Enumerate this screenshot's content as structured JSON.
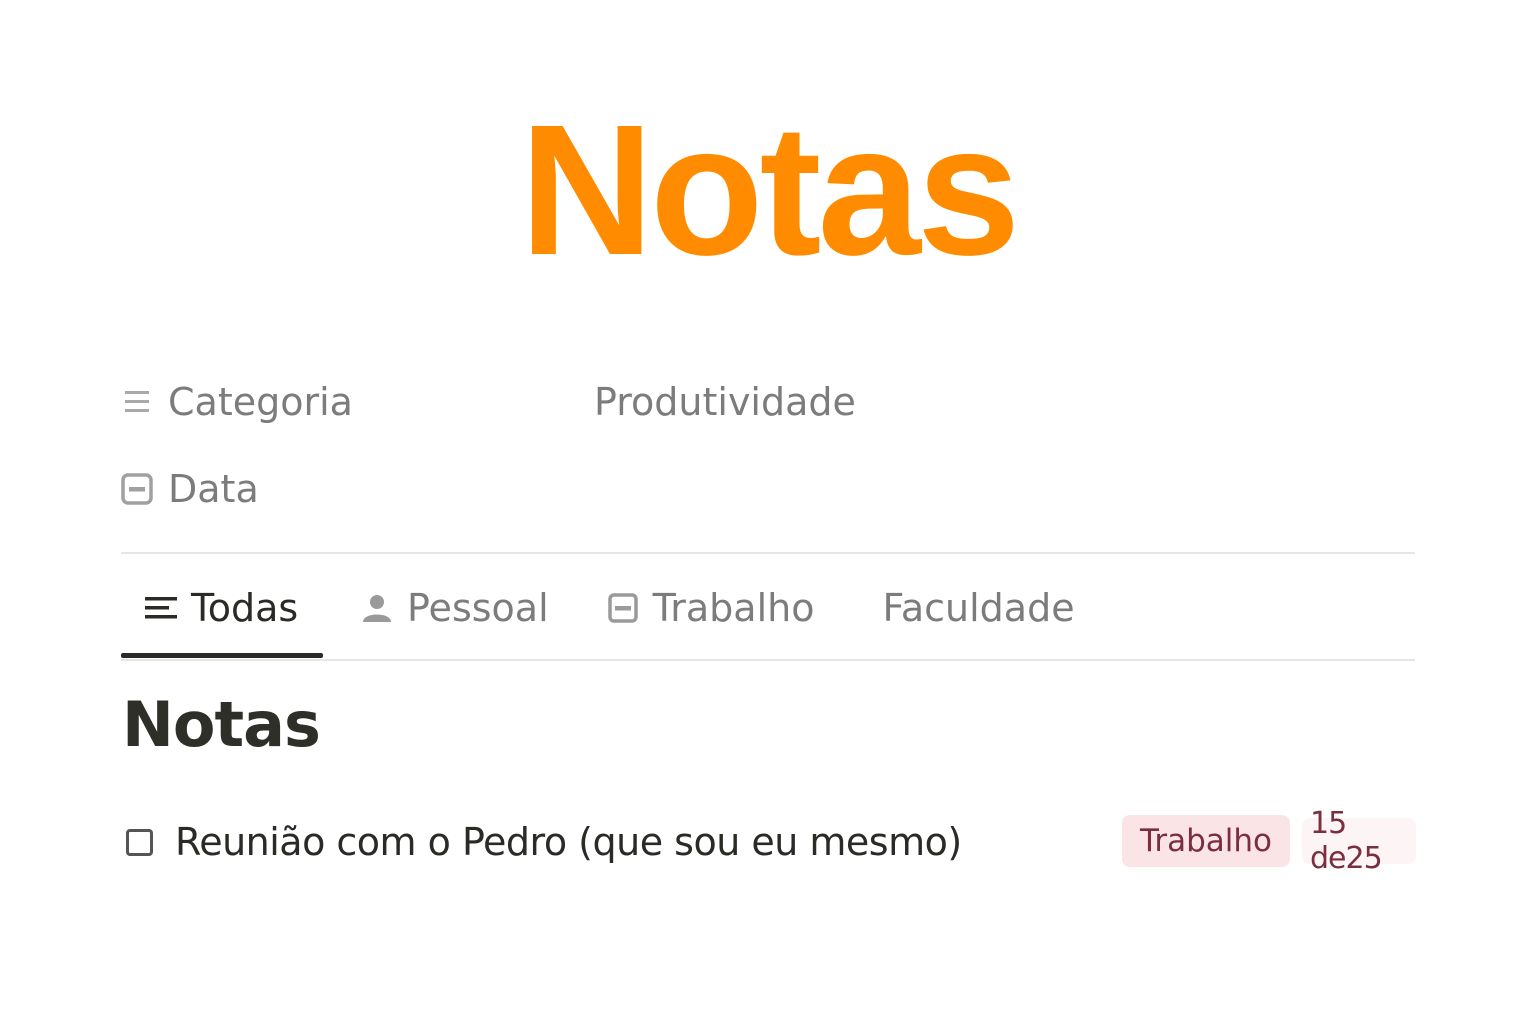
{
  "colors": {
    "accent": "#ff8c00",
    "text_dark": "#2a2a26",
    "text_muted": "#7c7c7c",
    "tag_bg": "#fbe4e6",
    "tag_text": "#7a2e3e",
    "date_bg": "#fdf4f5"
  },
  "header": {
    "title": "Notas"
  },
  "properties": {
    "category": {
      "icon": "list-icon",
      "label": "Categoria",
      "value": "Produtividade"
    },
    "date": {
      "icon": "calendar-icon",
      "label": "Data",
      "value": ""
    }
  },
  "tabs": [
    {
      "label": "Todas",
      "icon": "text-lines-icon",
      "active": true
    },
    {
      "label": "Pessoal",
      "icon": "person-icon",
      "active": false
    },
    {
      "label": "Trabalho",
      "icon": "calendar-icon",
      "active": false
    },
    {
      "label": "Faculdade",
      "icon": "",
      "active": false
    }
  ],
  "section": {
    "title": "Notas"
  },
  "tasks": [
    {
      "checked": false,
      "title": "Reunião com o Pedro (que sou eu mesmo)",
      "tag": "Trabalho",
      "date": "15 de25"
    }
  ]
}
